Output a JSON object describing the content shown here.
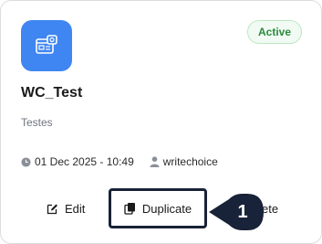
{
  "card": {
    "status": "Active",
    "title": "WC_Test",
    "description": "Testes",
    "date": "01 Dec 2025 - 10:49",
    "author": "writechoice",
    "icon": "app-window-icon"
  },
  "actions": {
    "edit_label": "Edit",
    "duplicate_label": "Duplicate",
    "delete_label_visible": "ete"
  },
  "annotation": {
    "step_number": "1"
  },
  "colors": {
    "accent": "#3f86f2",
    "status": "#2b8a3e",
    "highlight": "#182238"
  }
}
